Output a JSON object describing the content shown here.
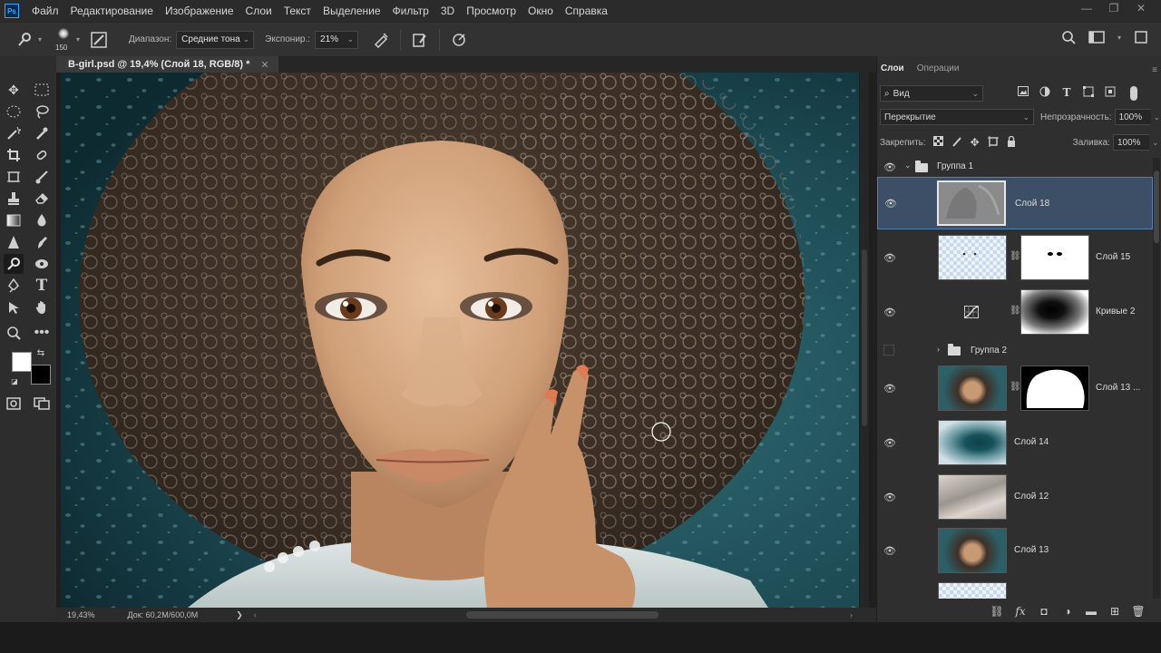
{
  "app": {
    "logo": "Ps",
    "menu": [
      "Файл",
      "Редактирование",
      "Изображение",
      "Слои",
      "Текст",
      "Выделение",
      "Фильтр",
      "3D",
      "Просмотр",
      "Окно",
      "Справка"
    ],
    "window_controls": [
      "—",
      "❐",
      "✕"
    ]
  },
  "options_bar": {
    "brush_size": "150",
    "range_label": "Диапазон:",
    "range_value": "Средние тона",
    "exposure_label": "Экспонир.:",
    "exposure_value": "21%"
  },
  "document": {
    "tab_title": "B-girl.psd @ 19,4% (Слой 18, RGB/8) *",
    "close": "✕"
  },
  "status_bar": {
    "zoom": "19,43%",
    "doc_info": "Док: 60,2M/600,0M",
    "arrow": "❯"
  },
  "colors": {
    "foreground": "#ffffff",
    "background": "#000000",
    "selection": "#3c4f66"
  },
  "layers_panel": {
    "tabs": [
      "Слои",
      "Операции"
    ],
    "filter_label": "Вид",
    "blend_mode": "Перекрытие",
    "opacity_label": "Непрозрачность:",
    "opacity_value": "100%",
    "lock_label": "Закрепить:",
    "fill_label": "Заливка:",
    "fill_value": "100%",
    "layers": [
      {
        "name": "Группа 1",
        "type": "group",
        "visible": true,
        "expanded": true
      },
      {
        "name": "Слой 18",
        "type": "layer",
        "visible": true,
        "selected": true
      },
      {
        "name": "Слой 15",
        "type": "layer-mask",
        "visible": true
      },
      {
        "name": "Кривые 2",
        "type": "adjustment",
        "visible": true
      },
      {
        "name": "Группа 2",
        "type": "group",
        "visible": false,
        "expanded": false
      },
      {
        "name": "Слой 13 ...",
        "type": "layer-mask",
        "visible": true
      },
      {
        "name": "Слой 14",
        "type": "layer",
        "visible": true
      },
      {
        "name": "Слой 12",
        "type": "layer",
        "visible": true
      },
      {
        "name": "Слой 13",
        "type": "layer",
        "visible": true
      }
    ]
  }
}
